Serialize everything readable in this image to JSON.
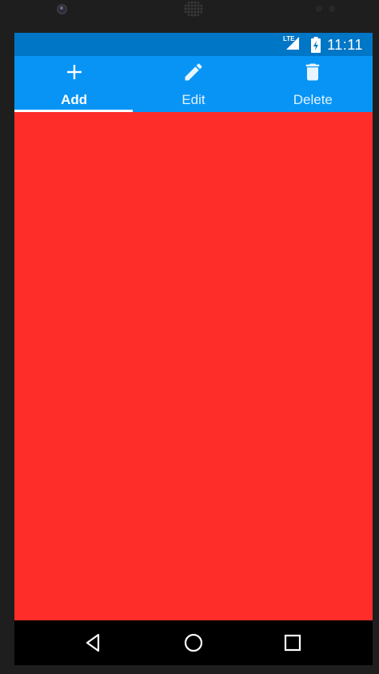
{
  "status_bar": {
    "network_label": "LTE",
    "time": "11:11"
  },
  "tabs": [
    {
      "label": "Add",
      "icon": "plus-icon",
      "selected": true
    },
    {
      "label": "Edit",
      "icon": "pencil-icon",
      "selected": false
    },
    {
      "label": "Delete",
      "icon": "trash-icon",
      "selected": false
    }
  ],
  "navigation_bar": {
    "buttons": [
      "back-icon",
      "home-icon",
      "recents-icon"
    ]
  },
  "colors": {
    "status_bar": "#0076c7",
    "tab_bar": "#0894f5",
    "content_background": "#ff2d2a",
    "navigation_bar": "#000000",
    "device_frame": "#1e1e1e"
  }
}
